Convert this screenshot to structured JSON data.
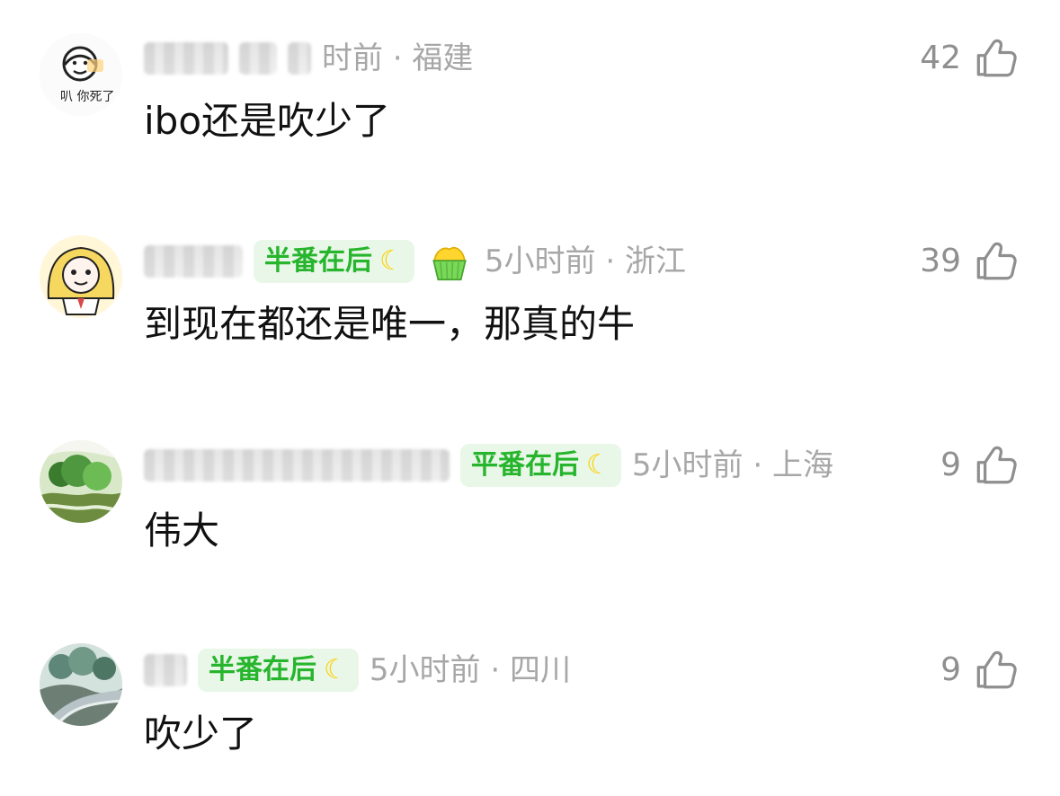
{
  "comments": [
    {
      "meta_text": "时前 · 福建",
      "likes": "42",
      "content": "ibo还是吹少了",
      "avatar_text": "叭 你死了",
      "has_badge": false
    },
    {
      "meta_text": "5小时前 · 浙江",
      "likes": "39",
      "content": "到现在都还是唯一，那真的牛",
      "badge_text": "半番在后",
      "has_badge": true
    },
    {
      "meta_text": "5小时前 · 上海",
      "likes": "9",
      "content": "伟大",
      "badge_text": "平番在后",
      "has_badge": true
    },
    {
      "meta_text": "5小时前 · 四川",
      "likes": "9",
      "content": "吹少了",
      "badge_text": "半番在后",
      "has_badge": true
    }
  ],
  "icons": {
    "like": "thumb-up-icon",
    "moon": "crescent-moon-icon",
    "cupcake": "cupcake-icon"
  },
  "colors": {
    "badge_bg": "#e8f7e7",
    "badge_text": "#27b52d",
    "meta_text": "#a7a7a7",
    "like_text": "#8f8f8f"
  }
}
